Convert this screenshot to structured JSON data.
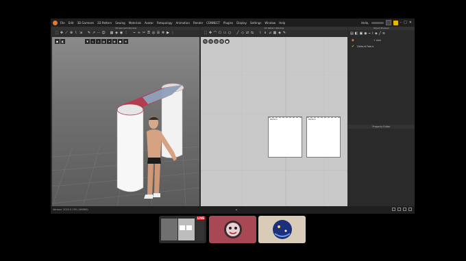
{
  "menu": {
    "items": [
      "File",
      "Edit",
      "3D Garment",
      "2D Pattern",
      "Sewing",
      "Materials",
      "Avatar",
      "Retopology",
      "Animation",
      "Render",
      "CONNECT",
      "Plugins",
      "Display",
      "Settings",
      "Window",
      "Help"
    ],
    "user_label": "Hello,"
  },
  "panels": {
    "view3d_title": "3D Garment Window",
    "view2d_title": "2D Pattern Window",
    "object_browser_title": "Object Browser",
    "property_editor_title": "Property Editor"
  },
  "object_browser": {
    "add_label": "+ Add",
    "item_label": "Default Fabric"
  },
  "patterns": {
    "left_label": "Pattern",
    "right_label": "Pattern"
  },
  "statusbar": {
    "text": "Version: 2025.0.155 (r56584)"
  },
  "thumbnails": {
    "live_badge": "LIVE"
  },
  "colors": {
    "accent": "#e8792b",
    "live": "#e0242e",
    "bg_2d": "#c9c9c9"
  }
}
